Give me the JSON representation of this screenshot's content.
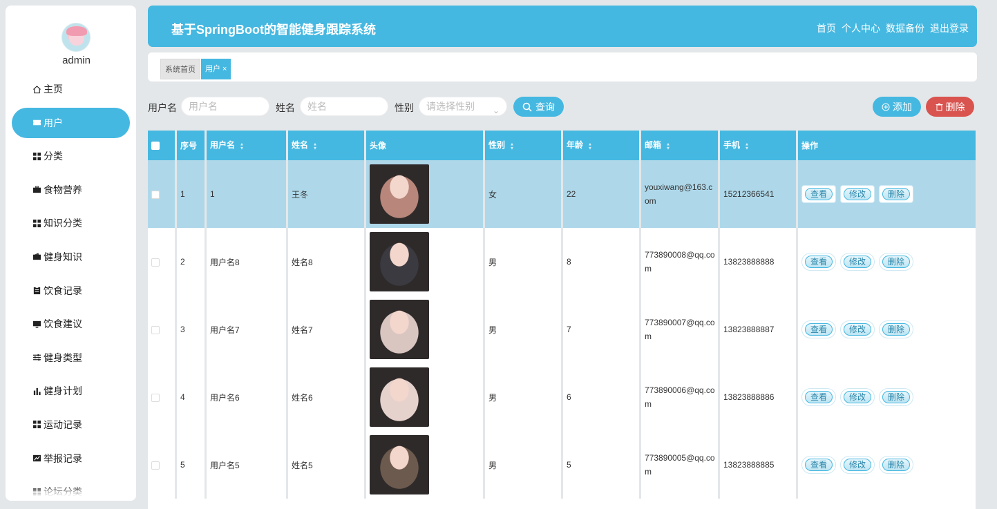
{
  "sidebar": {
    "username": "admin",
    "items": [
      {
        "label": "主页",
        "icon": "home-icon"
      },
      {
        "label": "用户",
        "icon": "ticket-icon",
        "active": true
      },
      {
        "label": "分类",
        "icon": "grid-icon"
      },
      {
        "label": "食物营养",
        "icon": "briefcase-icon"
      },
      {
        "label": "知识分类",
        "icon": "grid-icon"
      },
      {
        "label": "健身知识",
        "icon": "wallet-icon"
      },
      {
        "label": "饮食记录",
        "icon": "clipboard-icon"
      },
      {
        "label": "饮食建议",
        "icon": "monitor-icon"
      },
      {
        "label": "健身类型",
        "icon": "sliders-icon"
      },
      {
        "label": "健身计划",
        "icon": "bar-chart-icon"
      },
      {
        "label": "运动记录",
        "icon": "grid-icon"
      },
      {
        "label": "举报记录",
        "icon": "line-chart-icon"
      },
      {
        "label": "论坛分类",
        "icon": "grid-icon"
      }
    ]
  },
  "header": {
    "title": "基于SpringBoot的智能健身跟踪系统",
    "nav": [
      "首页",
      "个人中心",
      "数据备份",
      "退出登录"
    ]
  },
  "tabs": [
    {
      "label": "系统首页"
    },
    {
      "label": "用户 ×"
    }
  ],
  "search": {
    "username_label": "用户名",
    "username_placeholder": "用户名",
    "name_label": "姓名",
    "name_placeholder": "姓名",
    "gender_label": "性别",
    "gender_placeholder": "请选择性别",
    "query_button": "查询",
    "add_button": "添加",
    "delete_button": "删除"
  },
  "table": {
    "headers": [
      "序号",
      "用户名",
      "姓名",
      "头像",
      "性别",
      "年龄",
      "邮箱",
      "手机",
      "操作"
    ],
    "sortable": [
      false,
      true,
      true,
      false,
      true,
      true,
      true,
      true,
      false
    ],
    "ops": [
      "查看",
      "修改",
      "删除"
    ],
    "rows": [
      {
        "no": "1",
        "username": "1",
        "name": "王冬",
        "gender": "女",
        "age": "22",
        "email": "youxiwang@163.com",
        "phone": "15212366541",
        "highlight": true,
        "photo": "#b8867a"
      },
      {
        "no": "2",
        "username": "用户名8",
        "name": "姓名8",
        "gender": "男",
        "age": "8",
        "email": "773890008@qq.com",
        "phone": "13823888888",
        "photo": "#3a3a40"
      },
      {
        "no": "3",
        "username": "用户名7",
        "name": "姓名7",
        "gender": "男",
        "age": "7",
        "email": "773890007@qq.com",
        "phone": "13823888887",
        "photo": "#d9c6c0"
      },
      {
        "no": "4",
        "username": "用户名6",
        "name": "姓名6",
        "gender": "男",
        "age": "6",
        "email": "773890006@qq.com",
        "phone": "13823888886",
        "photo": "#e6d2cc"
      },
      {
        "no": "5",
        "username": "用户名5",
        "name": "姓名5",
        "gender": "男",
        "age": "5",
        "email": "773890005@qq.com",
        "phone": "13823888885",
        "photo": "#6d5a4e"
      }
    ]
  }
}
